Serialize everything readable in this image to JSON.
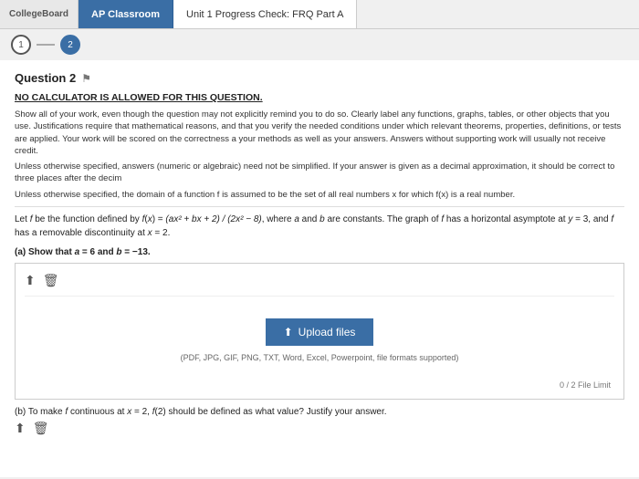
{
  "topbar": {
    "collegeboard_label": "CollegeBoard",
    "ap_classroom_label": "AP Classroom",
    "page_title": "Unit 1 Progress Check: FRQ Part A"
  },
  "breadcrumb": {
    "step1_label": "1",
    "step2_label": "2"
  },
  "question": {
    "title": "Question 2",
    "no_calc": "NO CALCULATOR IS ALLOWED FOR THIS QUESTION.",
    "instructions1": "Show all of your work, even though the question may not explicitly remind you to do so. Clearly label any functions, graphs, tables, or other objects that you use. Justifications require that mathematical reasons, and that you verify the needed conditions under which relevant theorems, properties, definitions, or tests are applied. Your work will be scored on the correctness a your methods as well as your answers. Answers without supporting work will usually not receive credit.",
    "instructions2": "Unless otherwise specified, answers (numeric or algebraic) need not be simplified. If your answer is given as a decimal approximation, it should be correct to three places after the decim",
    "instructions3": "Unless otherwise specified, the domain of a function f is assumed to be the set of all real numbers x for which f(x) is a real number.",
    "problem": "Let f be the function defined by f(x) = (ax² + bx + 2) / (2x² - 8), where a and b are constants. The graph of f has a horizontal asymptote at y = 3, and f has a removable discontinuity at x = 2.",
    "part_a_label": "(a) Show that a = 6 and b = −13.",
    "part_b_label": "(b) To make f continuous at x = 2, f(2) should be defined as what value? Justify your answer."
  },
  "upload": {
    "button_label": "Upload files",
    "formats": "(PDF, JPG, GIF, PNG, TXT, Word, Excel, Powerpoint, file formats supported)",
    "file_limit": "0 / 2 File Limit",
    "upload_icon": "⬆",
    "trash_icon": "🗑"
  },
  "toolbar": {
    "upload_icon": "⬆",
    "trash_icon": "🗑"
  }
}
